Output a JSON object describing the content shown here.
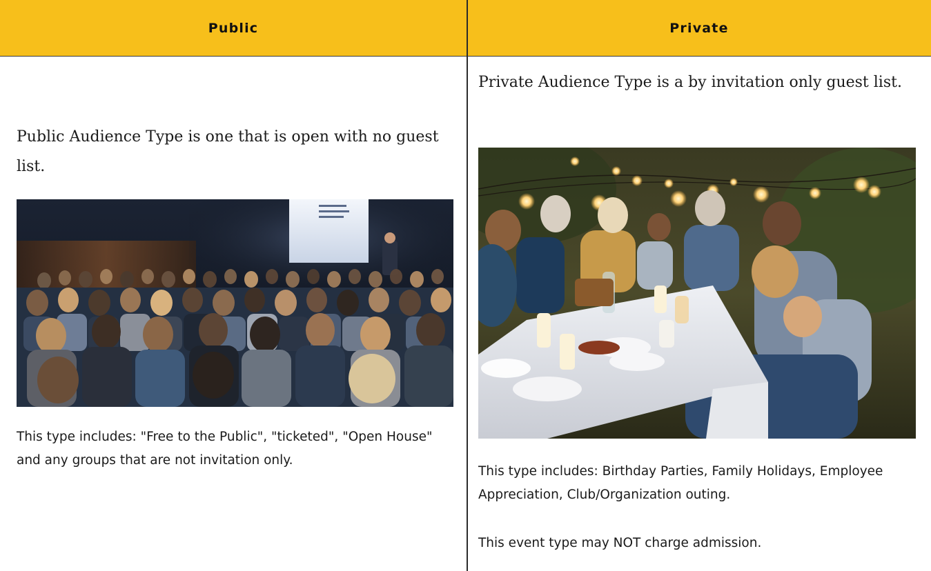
{
  "table": {
    "columns": [
      {
        "heading": "Public",
        "lead": "Public Audience Type is one that is open with no guest list.",
        "photo_icon": "conference-audience-photo",
        "description": "This type includes: \"Free to the Public\", \"ticketed\", \"Open House\" and any groups that are not invitation only."
      },
      {
        "heading": "Private",
        "lead": "Private Audience Type is a by invitation only guest list.",
        "photo_icon": "family-dinner-party-photo",
        "description": "This type includes: Birthday Parties, Family Holidays, Employee Appreciation, Club/Organization outing.",
        "note": "This event type may NOT charge admission."
      }
    ]
  },
  "colors": {
    "header_background": "#f7bf1b",
    "divider": "#2a2a2a",
    "text": "#1a1a1a"
  }
}
